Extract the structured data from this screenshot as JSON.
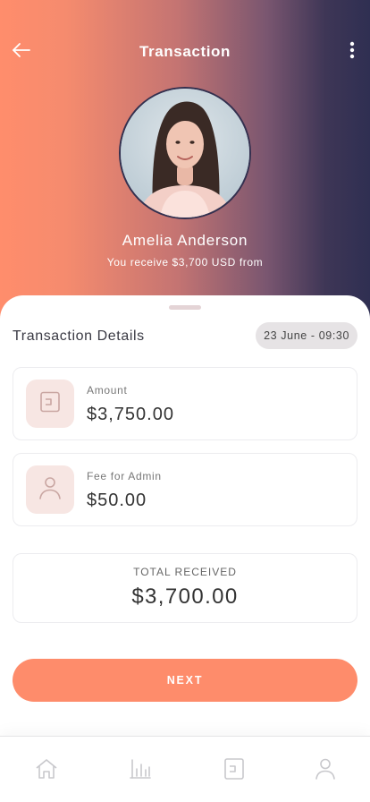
{
  "header": {
    "title": "Transaction",
    "back_icon": "arrow-left-icon",
    "menu_icon": "more-vertical-icon"
  },
  "profile": {
    "name": "Amelia Anderson",
    "subtitle": "You receive $3,700 USD from"
  },
  "details": {
    "title": "Transaction Details",
    "date": "23 June - 09:30",
    "items": [
      {
        "label": "Amount",
        "value": "$3,750.00",
        "icon": "wallet-icon"
      },
      {
        "label": "Fee for Admin",
        "value": "$50.00",
        "icon": "user-icon"
      }
    ],
    "total_label": "TOTAL RECEIVED",
    "total_value": "$3,700.00"
  },
  "actions": {
    "next_label": "NEXT"
  },
  "nav": {
    "items": [
      {
        "icon": "home-icon"
      },
      {
        "icon": "chart-icon"
      },
      {
        "icon": "wallet-icon"
      },
      {
        "icon": "profile-icon"
      }
    ]
  },
  "colors": {
    "accent": "#fe8c6b",
    "gradient_start": "#ff8d6c",
    "gradient_end": "#2f2f52",
    "icon_tile": "#f7e6e3"
  }
}
